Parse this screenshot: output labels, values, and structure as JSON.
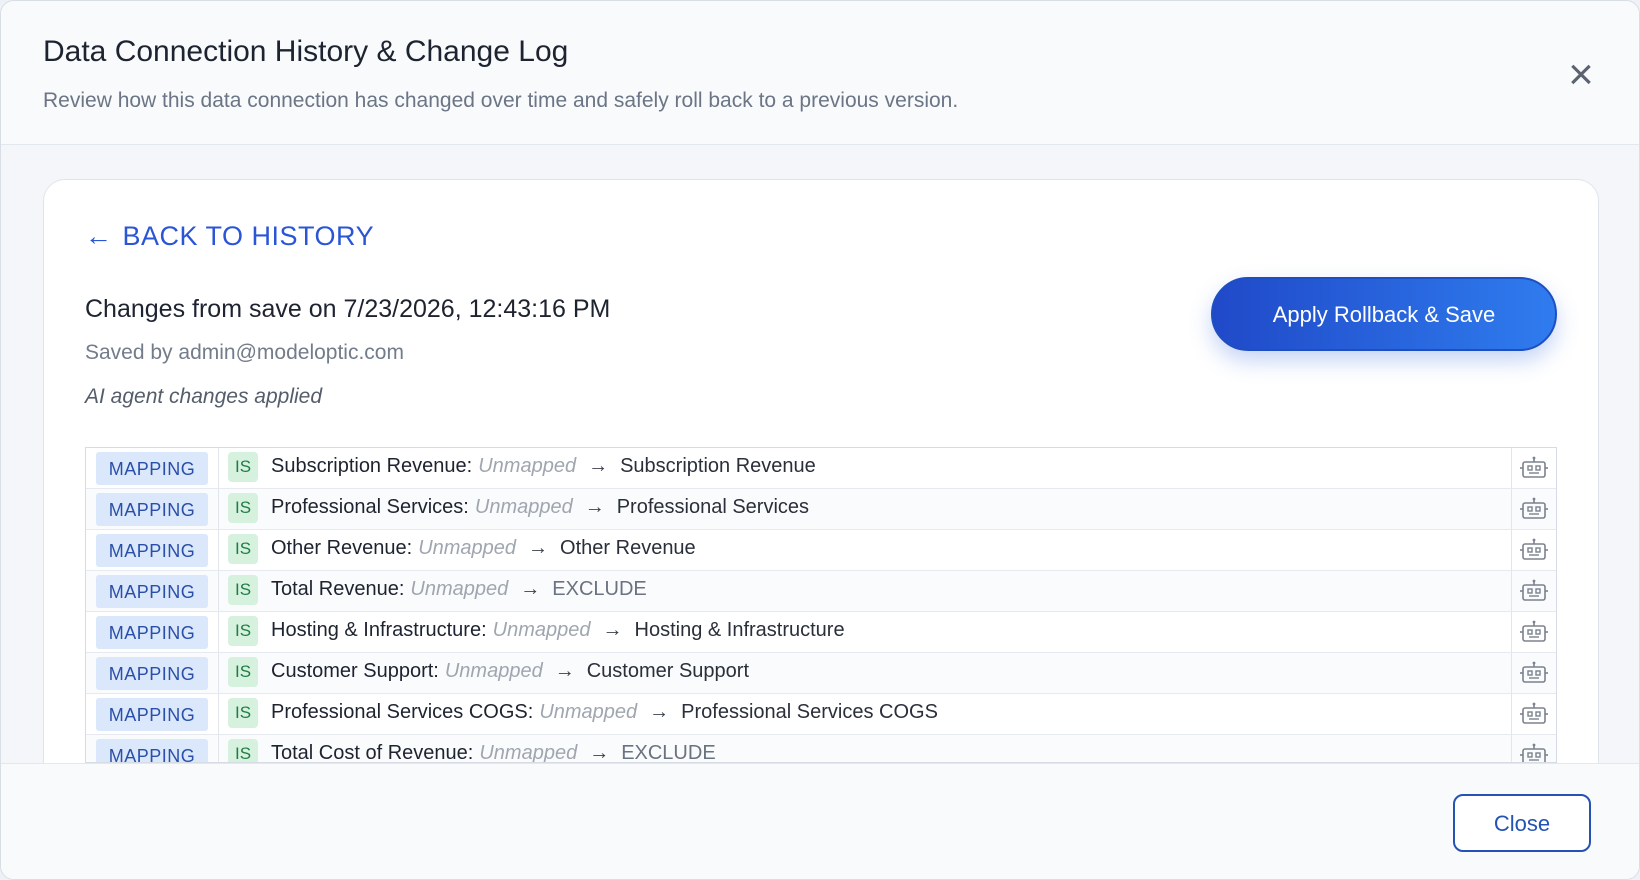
{
  "header": {
    "title": "Data Connection History & Change Log",
    "subtitle": "Review how this data connection has changed over time and safely roll back to a previous version.",
    "close_icon": "×"
  },
  "detail": {
    "back_arrow": "←",
    "back_label": "BACK TO HISTORY",
    "changes_title": "Changes from save on 7/23/2026, 12:43:16 PM",
    "saved_by": "Saved by admin@modeloptic.com",
    "ai_note": "AI agent changes applied",
    "apply_label": "Apply Rollback & Save"
  },
  "rows": [
    {
      "tag": "MAPPING",
      "badge": "IS",
      "field": "Subscription Revenue:",
      "from": "Unmapped",
      "arrow": "→",
      "to": "Subscription Revenue",
      "icon": "robot-icon"
    },
    {
      "tag": "MAPPING",
      "badge": "IS",
      "field": "Professional Services:",
      "from": "Unmapped",
      "arrow": "→",
      "to": "Professional Services",
      "icon": "robot-icon"
    },
    {
      "tag": "MAPPING",
      "badge": "IS",
      "field": "Other Revenue:",
      "from": "Unmapped",
      "arrow": "→",
      "to": "Other Revenue",
      "icon": "robot-icon"
    },
    {
      "tag": "MAPPING",
      "badge": "IS",
      "field": "Total Revenue:",
      "from": "Unmapped",
      "arrow": "→",
      "to": "EXCLUDE",
      "icon": "robot-icon"
    },
    {
      "tag": "MAPPING",
      "badge": "IS",
      "field": "Hosting & Infrastructure:",
      "from": "Unmapped",
      "arrow": "→",
      "to": "Hosting & Infrastructure",
      "icon": "robot-icon"
    },
    {
      "tag": "MAPPING",
      "badge": "IS",
      "field": "Customer Support:",
      "from": "Unmapped",
      "arrow": "→",
      "to": "Customer Support",
      "icon": "robot-icon"
    },
    {
      "tag": "MAPPING",
      "badge": "IS",
      "field": "Professional Services COGS:",
      "from": "Unmapped",
      "arrow": "→",
      "to": "Professional Services COGS",
      "icon": "robot-icon"
    },
    {
      "tag": "MAPPING",
      "badge": "IS",
      "field": "Total Cost of Revenue:",
      "from": "Unmapped",
      "arrow": "→",
      "to": "EXCLUDE",
      "icon": "robot-icon"
    }
  ],
  "footer": {
    "close_label": "Close"
  },
  "colors": {
    "accent": "#2a55d6",
    "tag_bg": "#dbe8fb",
    "badge_bg": "#d6f1de"
  }
}
